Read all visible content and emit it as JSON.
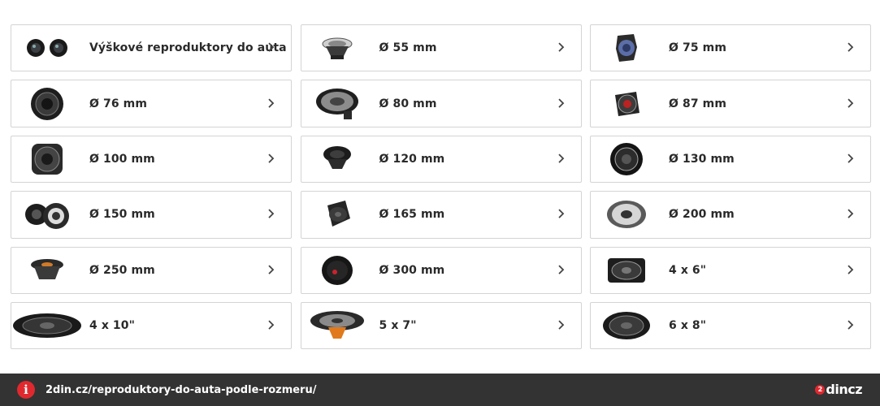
{
  "categories": [
    {
      "label": "Výškové reproduktory do auta",
      "icon": "tweeter-pair-icon"
    },
    {
      "label": "Ø 55 mm",
      "icon": "speaker-55mm-icon"
    },
    {
      "label": "Ø 75 mm",
      "icon": "speaker-75mm-icon"
    },
    {
      "label": "Ø 76 mm",
      "icon": "speaker-76mm-icon"
    },
    {
      "label": "Ø 80 mm",
      "icon": "speaker-80mm-icon"
    },
    {
      "label": "Ø 87 mm",
      "icon": "speaker-87mm-icon"
    },
    {
      "label": "Ø 100 mm",
      "icon": "speaker-100mm-icon"
    },
    {
      "label": "Ø 120 mm",
      "icon": "speaker-120mm-icon"
    },
    {
      "label": "Ø 130 mm",
      "icon": "speaker-130mm-icon"
    },
    {
      "label": "Ø 150 mm",
      "icon": "speaker-150mm-icon"
    },
    {
      "label": "Ø 165 mm",
      "icon": "speaker-165mm-icon"
    },
    {
      "label": "Ø 200 mm",
      "icon": "speaker-200mm-icon"
    },
    {
      "label": "Ø 250 mm",
      "icon": "speaker-250mm-icon"
    },
    {
      "label": "Ø 300 mm",
      "icon": "subwoofer-300mm-icon"
    },
    {
      "label": "4 x 6\"",
      "icon": "speaker-4x6-icon"
    },
    {
      "label": "4 x 10\"",
      "icon": "speaker-4x10-icon"
    },
    {
      "label": "5 x 7\"",
      "icon": "speaker-5x7-icon"
    },
    {
      "label": "6 x 8\"",
      "icon": "speaker-6x8-icon"
    }
  ],
  "footer": {
    "url": "2din.cz/reproduktory-do-auta-podle-rozmeru/",
    "info_icon_glyph": "i",
    "logo_badge": "2",
    "logo_text": "dincz"
  },
  "colors": {
    "card_border": "#d4d4d4",
    "footer_bg": "#333333",
    "accent_red": "#e0282f"
  }
}
